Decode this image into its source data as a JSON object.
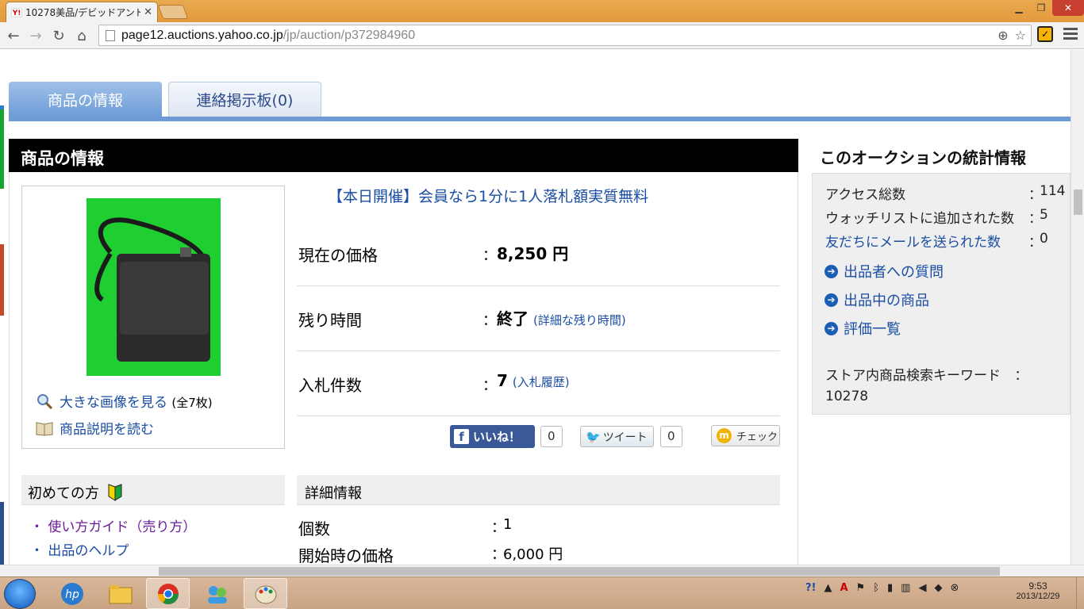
{
  "browser": {
    "tab_title": "10278美品/デビッドアンドスコ",
    "url_host": "page12.auctions.yahoo.co.jp",
    "url_path": "/jp/auction/p372984960"
  },
  "tabs": {
    "product_info": "商品の情報",
    "contact_board": "連絡掲示板(0)"
  },
  "main": {
    "section_title": "商品の情報",
    "banner_link": "【本日開催】会員なら1分に1人落札額実質無料",
    "image_links": {
      "large_image": "大きな画像を見る",
      "image_count": "(全7枚)",
      "read_description": "商品説明を読む"
    },
    "price": {
      "label": "現在の価格",
      "colon": "：",
      "value": "8,250 円"
    },
    "time_left": {
      "label": "残り時間",
      "colon": "：",
      "value": "終了",
      "link": "(詳細な残り時間)"
    },
    "bids": {
      "label": "入札件数",
      "colon": "：",
      "value": "7",
      "link": "(入札履歴)"
    },
    "social": {
      "like_label": "いいね！",
      "like_count": "0",
      "tweet_label": "ツイート",
      "tweet_count": "0",
      "check_label": "チェック"
    }
  },
  "beginner": {
    "title": "初めての方",
    "links": [
      "使い方ガイド（売り方）",
      "出品のヘルプ"
    ]
  },
  "details": {
    "title": "詳細情報",
    "rows": [
      {
        "label": "個数",
        "colon": "：",
        "value": "1"
      },
      {
        "label": "開始時の価格",
        "colon": "：",
        "value": "6,000 円"
      }
    ]
  },
  "stats": {
    "title": "このオークションの統計情報",
    "rows": [
      {
        "label": "アクセス総数",
        "colon": "：",
        "value": "114"
      },
      {
        "label": "ウォッチリストに追加された数",
        "colon": "：",
        "value": "5"
      },
      {
        "label": "友だちにメールを送られた数",
        "colon": "：",
        "value": "0"
      }
    ],
    "links": [
      "出品者への質問",
      "出品中の商品",
      "評価一覧"
    ],
    "keyword_label": "ストア内商品検索キーワード",
    "keyword_colon": "：",
    "keyword_value": "10278"
  },
  "taskbar": {
    "time": "9:53",
    "date": "2013/12/29"
  },
  "icons": {
    "back": "back-arrow-icon",
    "forward": "forward-arrow-icon",
    "reload": "reload-icon",
    "home": "home-icon",
    "zoom": "zoom-icon",
    "bookmark": "star-icon"
  },
  "colors": {
    "link": "#1a4da3",
    "tab_active": "#6e9bd6",
    "header_black": "#000000",
    "facebook": "#3b5998"
  }
}
